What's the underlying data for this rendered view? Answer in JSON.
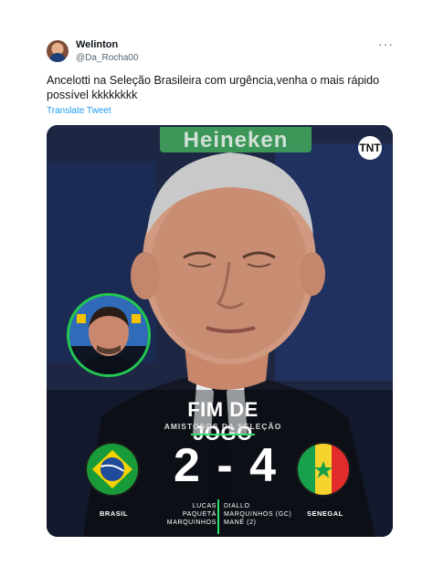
{
  "tweet": {
    "author_name": "Welinton",
    "author_handle": "@Da_Rocha00",
    "more_icon": "more-horizontal-icon",
    "text": "Ancelotti na Seleção Brasileira com urgência,venha o mais rápido possível kkkkkkkk",
    "translate_label": "Translate Tweet"
  },
  "media": {
    "background_banner_text": "Heineken",
    "logo_text": "TNT",
    "graphic": {
      "title": "FIM DE JOGO",
      "subtitle": "AMISTOSOS DA SELEÇÃO",
      "home_team": "BRASIL",
      "away_team": "SENEGAL",
      "score": "2 - 4",
      "home_scorers": [
        "LUCAS PAQUETÁ",
        "MARQUINHOS"
      ],
      "away_scorers": [
        "DIALLO",
        "MARQUINHOS (GC)",
        "MANÉ (2)"
      ]
    }
  },
  "colors": {
    "link_blue": "#1d9bf0",
    "accent_green": "#2fe06b",
    "brazil_green": "#1a9b3a",
    "brazil_yellow": "#f5d300",
    "brazil_blue": "#1f4b9b",
    "senegal_green": "#18a04b",
    "senegal_yellow": "#f6d32d",
    "senegal_red": "#e22b2b"
  }
}
